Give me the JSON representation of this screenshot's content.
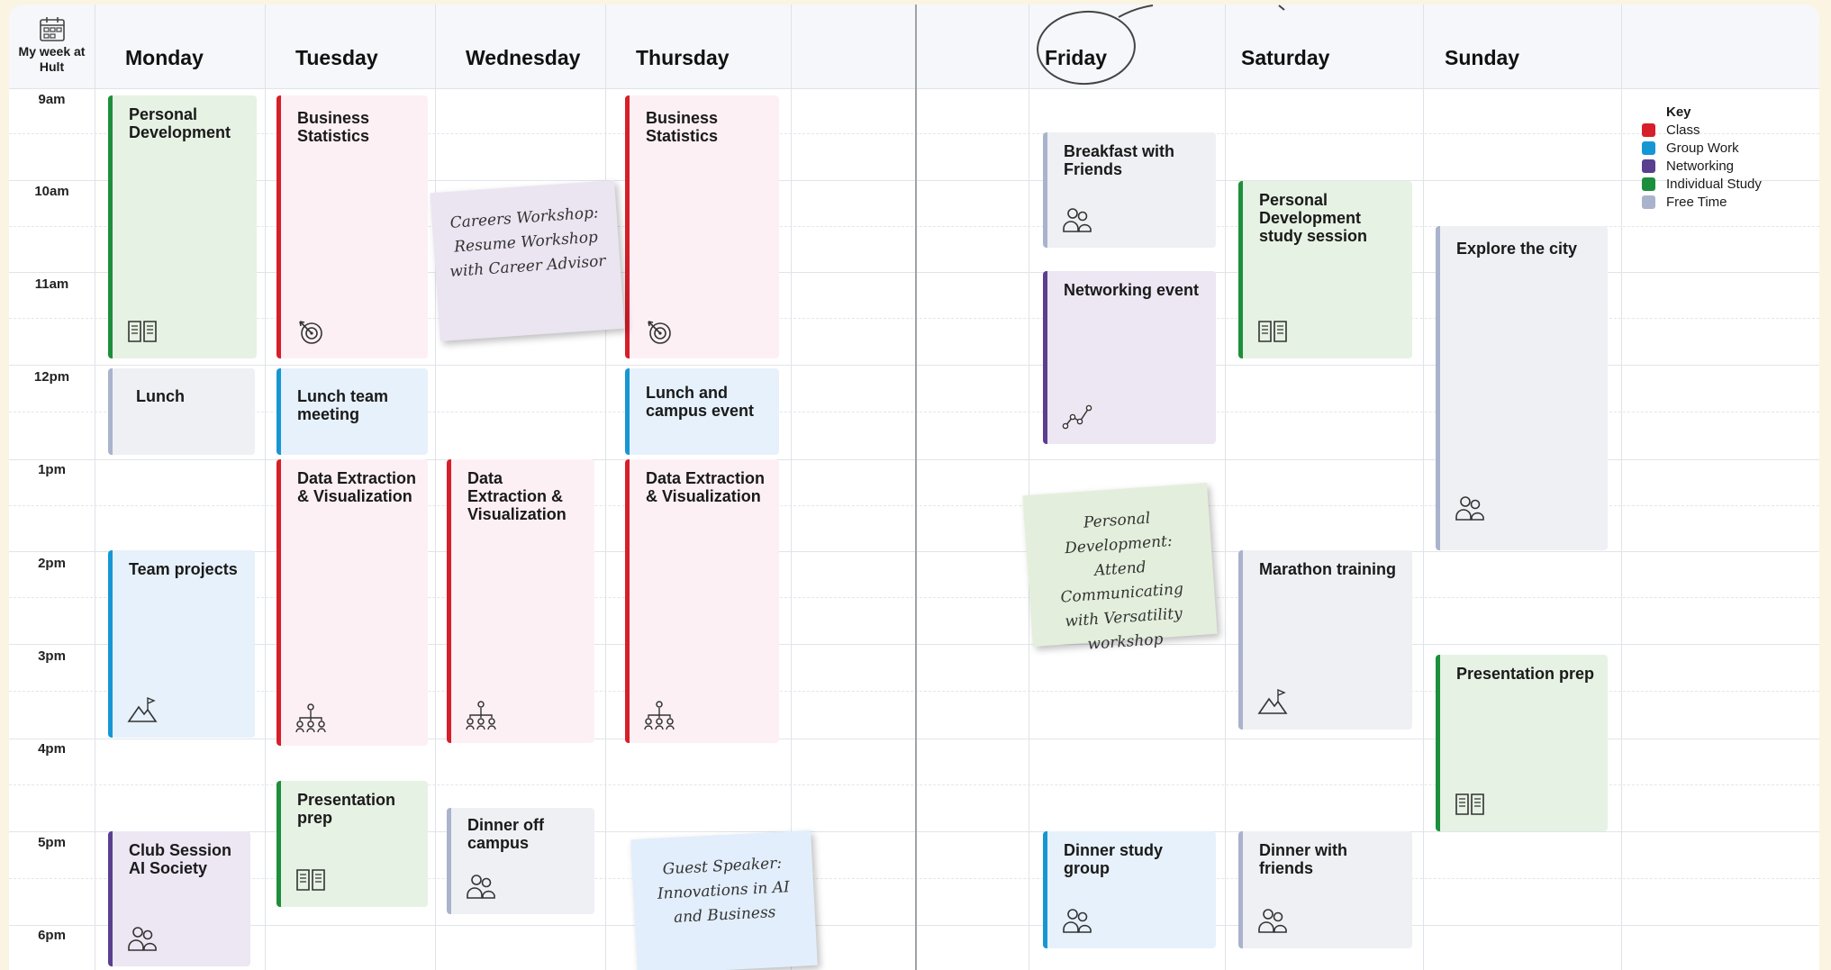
{
  "corner_label": "My week at Hult",
  "days": [
    {
      "key": "mon",
      "label": "Monday"
    },
    {
      "key": "tue",
      "label": "Tuesday"
    },
    {
      "key": "wed",
      "label": "Wednesday"
    },
    {
      "key": "thu",
      "label": "Thursday"
    },
    {
      "key": "fri",
      "label": "Friday"
    },
    {
      "key": "sat",
      "label": "Saturday"
    },
    {
      "key": "sun",
      "label": "Sunday"
    }
  ],
  "times": [
    "9am",
    "10am",
    "11am",
    "12pm",
    "1pm",
    "2pm",
    "3pm",
    "4pm",
    "5pm",
    "6pm"
  ],
  "key": {
    "title": "Key",
    "items": [
      {
        "label": "Class",
        "color": "#d71f2a"
      },
      {
        "label": "Group Work",
        "color": "#1796d4"
      },
      {
        "label": "Networking",
        "color": "#5a3f8f"
      },
      {
        "label": "Individual Study",
        "color": "#1d8f3c"
      },
      {
        "label": "Free Time",
        "color": "#a9b3cc"
      }
    ]
  },
  "events": [
    {
      "title": "Personal Development",
      "category": "Individual Study",
      "icon": "book-icon"
    },
    {
      "title": "Lunch",
      "category": "Free Time",
      "icon": ""
    },
    {
      "title": "Team projects",
      "category": "Group Work",
      "icon": "mountain-flag-icon"
    },
    {
      "title": "Club Session AI Society",
      "category": "Networking",
      "icon": "people-icon"
    },
    {
      "title": "Business Statistics",
      "category": "Class",
      "icon": "target-icon"
    },
    {
      "title": "Lunch team meeting",
      "category": "Group Work",
      "icon": ""
    },
    {
      "title": "Data Extraction & Visualization",
      "category": "Class",
      "icon": "network-people-icon"
    },
    {
      "title": "Presentation prep",
      "category": "Individual Study",
      "icon": "book-icon"
    },
    {
      "title": "Data Extraction & Visualization",
      "category": "Class",
      "icon": "network-people-icon"
    },
    {
      "title": "Dinner off campus",
      "category": "Free Time",
      "icon": "people-icon"
    },
    {
      "title": "Business Statistics",
      "category": "Class",
      "icon": "target-icon"
    },
    {
      "title": "Lunch and campus event",
      "category": "Group Work",
      "icon": ""
    },
    {
      "title": "Data Extraction & Visualization",
      "category": "Class",
      "icon": "network-people-icon"
    },
    {
      "title": "Breakfast with Friends",
      "category": "Free Time",
      "icon": "people-icon"
    },
    {
      "title": "Networking event",
      "category": "Networking",
      "icon": "line-graph-icon"
    },
    {
      "title": "Dinner study group",
      "category": "Group Work",
      "icon": "people-icon"
    },
    {
      "title": "Personal Development study session",
      "category": "Individual Study",
      "icon": "book-icon"
    },
    {
      "title": "Marathon training",
      "category": "Free Time",
      "icon": "mountain-flag-icon"
    },
    {
      "title": "Dinner with friends",
      "category": "Free Time",
      "icon": "people-icon"
    },
    {
      "title": "Explore the city",
      "category": "Free Time",
      "icon": "people-icon"
    },
    {
      "title": "Presentation prep",
      "category": "Individual Study",
      "icon": "book-icon"
    }
  ],
  "notes": [
    {
      "text": "Careers Workshop: Resume Workshop with Career Advisor"
    },
    {
      "text": "Personal Development: Attend Communicating with Versatility workshop"
    },
    {
      "text": "Guest Speaker: Innovations in AI and Business"
    }
  ]
}
